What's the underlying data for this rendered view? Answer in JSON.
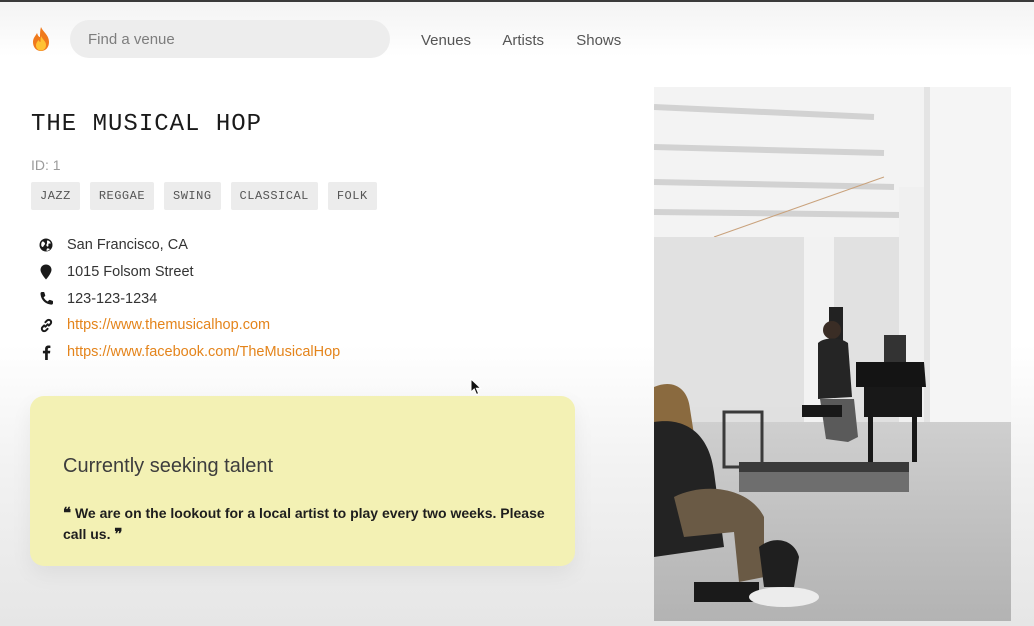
{
  "nav": {
    "search_placeholder": "Find a venue",
    "links": [
      "Venues",
      "Artists",
      "Shows"
    ]
  },
  "venue": {
    "name": "THE MUSICAL HOP",
    "id_label": "ID: 1",
    "genres": [
      "JAZZ",
      "REGGAE",
      "SWING",
      "CLASSICAL",
      "FOLK"
    ],
    "city": "San Francisco, CA",
    "address": "1015 Folsom Street",
    "phone": "123-123-1234",
    "website": "https://www.themusicalhop.com",
    "facebook": "https://www.facebook.com/TheMusicalHop"
  },
  "seeking": {
    "title": "Currently seeking talent",
    "description": "We are on the lookout for a local artist to play every two weeks. Please call us."
  },
  "icons": {
    "logo": "flame-icon",
    "city": "globe-icon",
    "address": "map-pin-icon",
    "phone": "phone-icon",
    "website": "link-icon",
    "facebook": "facebook-icon",
    "quote_open": "quote-left-icon",
    "quote_close": "quote-right-icon"
  },
  "colors": {
    "link": "#e4841b",
    "seeking_bg": "#f3f1b4",
    "tag_bg": "#ececec"
  }
}
